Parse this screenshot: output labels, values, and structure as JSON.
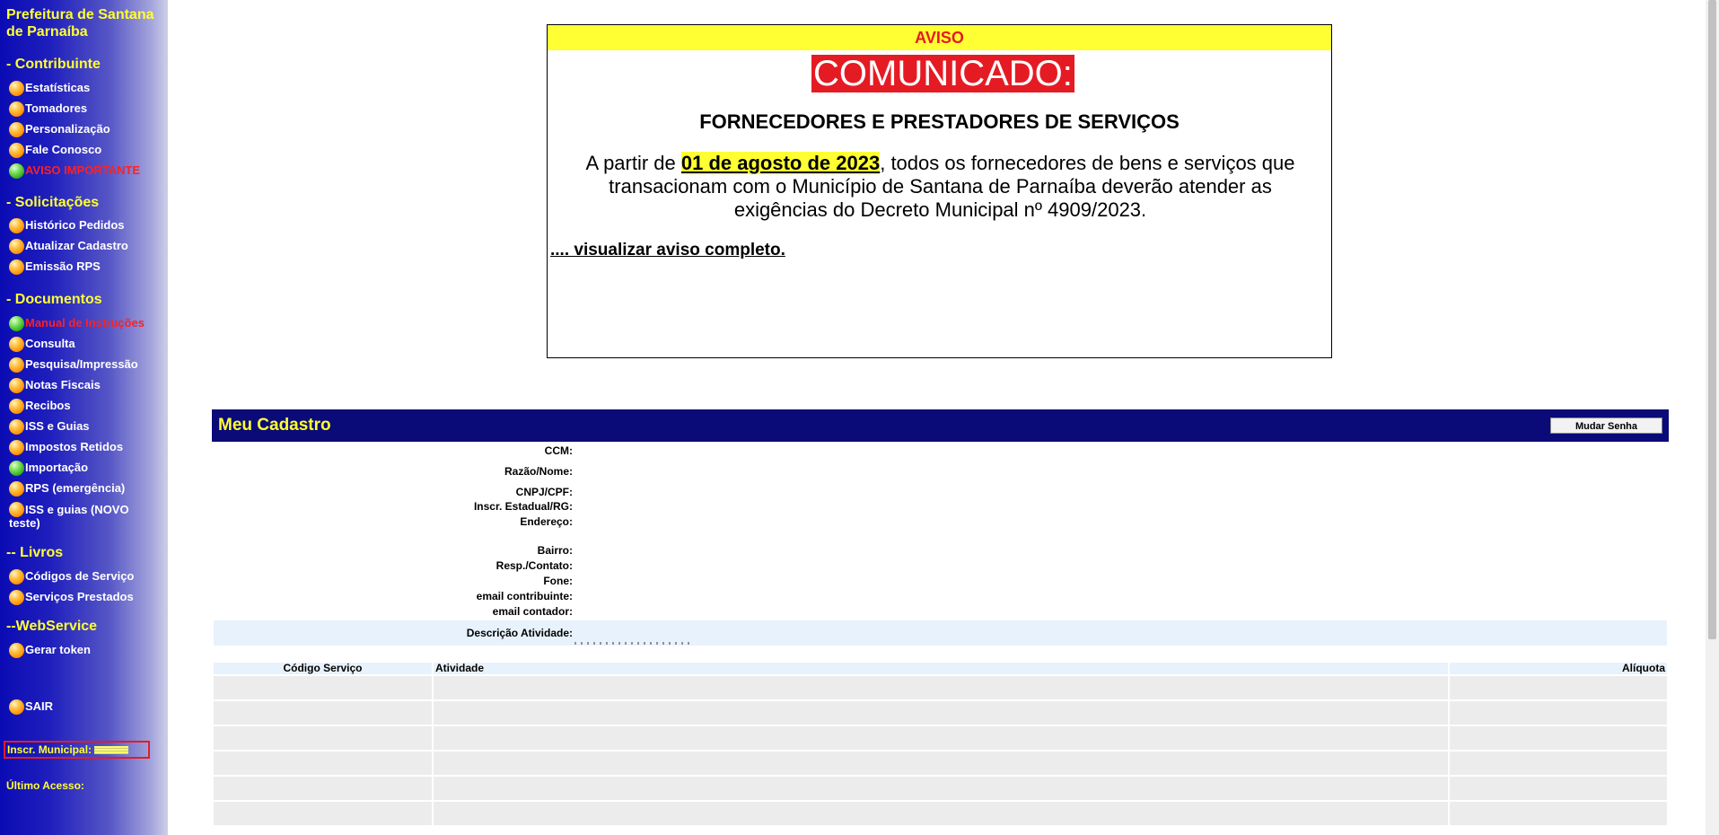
{
  "sidebar": {
    "title": "Prefeitura de Santana de Parnaíba",
    "sections": [
      {
        "heading": "- Contribuinte",
        "items": [
          {
            "label": "Estatísticas",
            "color": "orange",
            "style": ""
          },
          {
            "label": "Tomadores",
            "color": "orange",
            "style": ""
          },
          {
            "label": "Personalização",
            "color": "orange",
            "style": ""
          },
          {
            "label": "Fale Conosco",
            "color": "orange",
            "style": ""
          },
          {
            "label": "AVISO IMPORTANTE",
            "color": "green",
            "style": "red"
          }
        ]
      },
      {
        "heading": "- Solicitações",
        "items": [
          {
            "label": "Histórico Pedidos",
            "color": "orange",
            "style": ""
          },
          {
            "label": "Atualizar Cadastro",
            "color": "orange",
            "style": ""
          },
          {
            "label": "Emissão RPS",
            "color": "orange",
            "style": ""
          }
        ]
      },
      {
        "heading": "- Documentos",
        "items": [
          {
            "label": "Manual de Instruções",
            "color": "green",
            "style": "red"
          },
          {
            "label": "Consulta",
            "color": "orange",
            "style": ""
          },
          {
            "label": "Pesquisa/Impressão",
            "color": "orange",
            "style": ""
          },
          {
            "label": "Notas Fiscais",
            "color": "orange",
            "style": ""
          },
          {
            "label": "Recibos",
            "color": "orange",
            "style": ""
          },
          {
            "label": "ISS e Guias",
            "color": "orange",
            "style": ""
          },
          {
            "label": "Impostos Retidos",
            "color": "orange",
            "style": ""
          },
          {
            "label": "Importação",
            "color": "green",
            "style": ""
          },
          {
            "label": "RPS (emergência)",
            "color": "orange",
            "style": ""
          },
          {
            "label": "ISS e guias (NOVO teste)",
            "color": "orange",
            "style": "wrap"
          }
        ]
      },
      {
        "heading": "-- Livros",
        "items": [
          {
            "label": "Códigos de Serviço",
            "color": "orange",
            "style": ""
          },
          {
            "label": "Serviços Prestados",
            "color": "orange",
            "style": ""
          }
        ]
      },
      {
        "heading": "--WebService",
        "items": [
          {
            "label": "Gerar token",
            "color": "orange",
            "style": ""
          }
        ]
      }
    ],
    "sair": "SAIR",
    "inscr_municipal_label": "Inscr. Municipal:",
    "ultimo_acesso_label": "Último Acesso:"
  },
  "aviso": {
    "header": "AVISO",
    "comunicado": "COMUNICADO:",
    "subtitle": "FORNECEDORES E PRESTADORES DE SERVIÇOS",
    "body_before": "A partir de ",
    "body_date": "01 de agosto de 2023",
    "body_after": ", todos os fornecedores de bens e serviços que transacionam com o Município de Santana de Parnaíba deverão atender as exigências do Decreto Municipal nº 4909/2023.",
    "link": ".... visualizar aviso completo."
  },
  "cadastro": {
    "title": "Meu Cadastro",
    "change_password": "Mudar Senha",
    "fields": {
      "ccm": "CCM:",
      "razao": "Razão/Nome:",
      "cnpj": "CNPJ/CPF:",
      "inscr_estadual": "Inscr. Estadual/RG:",
      "endereco": "Endereço:",
      "bairro": "Bairro:",
      "resp": "Resp./Contato:",
      "fone": "Fone:",
      "email_contribuinte": "email contribuinte:",
      "email_contador": "email contador:",
      "descricao": "Descrição Atividade:"
    }
  },
  "services_table": {
    "columns": [
      "Código Serviço",
      "Atividade",
      "Alíquota"
    ],
    "rows": [
      [
        "",
        "",
        ""
      ],
      [
        "",
        "",
        ""
      ],
      [
        "",
        "",
        ""
      ],
      [
        "",
        "",
        ""
      ],
      [
        "",
        "",
        ""
      ],
      [
        "",
        "",
        ""
      ]
    ]
  }
}
